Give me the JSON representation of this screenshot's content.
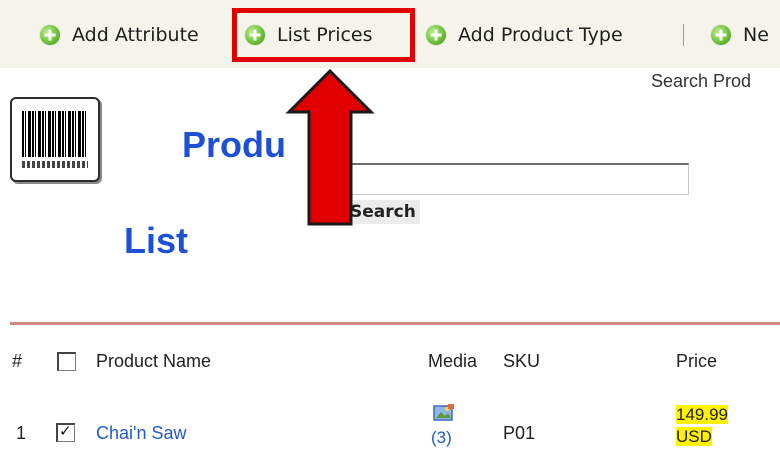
{
  "toolbar": {
    "items": [
      {
        "label": "Add Attribute",
        "icon": "plus-circle-icon"
      },
      {
        "label": "List Prices",
        "icon": "plus-circle-icon"
      },
      {
        "label": "Add Product Type",
        "icon": "plus-circle-icon"
      },
      {
        "label": "Ne",
        "icon": "plus-circle-icon"
      }
    ],
    "highlighted_item": "List Prices",
    "highlight_color": "#e00000"
  },
  "search": {
    "label": "Search Prod",
    "input_value": "",
    "button_label": "Search"
  },
  "page_title": {
    "line1": "Produ",
    "line2": "List",
    "color": "#1e50d6"
  },
  "annotation": {
    "arrow_color": "#e00000",
    "arrow_direction": "up"
  },
  "table": {
    "columns": [
      "#",
      "Product Name",
      "Media",
      "SKU",
      "Price"
    ],
    "rows": [
      {
        "index": "1",
        "checked": true,
        "product_name": "Chai'n Saw",
        "media_count": "(3)",
        "sku": "P01",
        "price_amount": "149.99",
        "price_currency": "USD"
      }
    ],
    "price_highlight_color": "#fff200",
    "header_line_color": "#d08a80"
  }
}
